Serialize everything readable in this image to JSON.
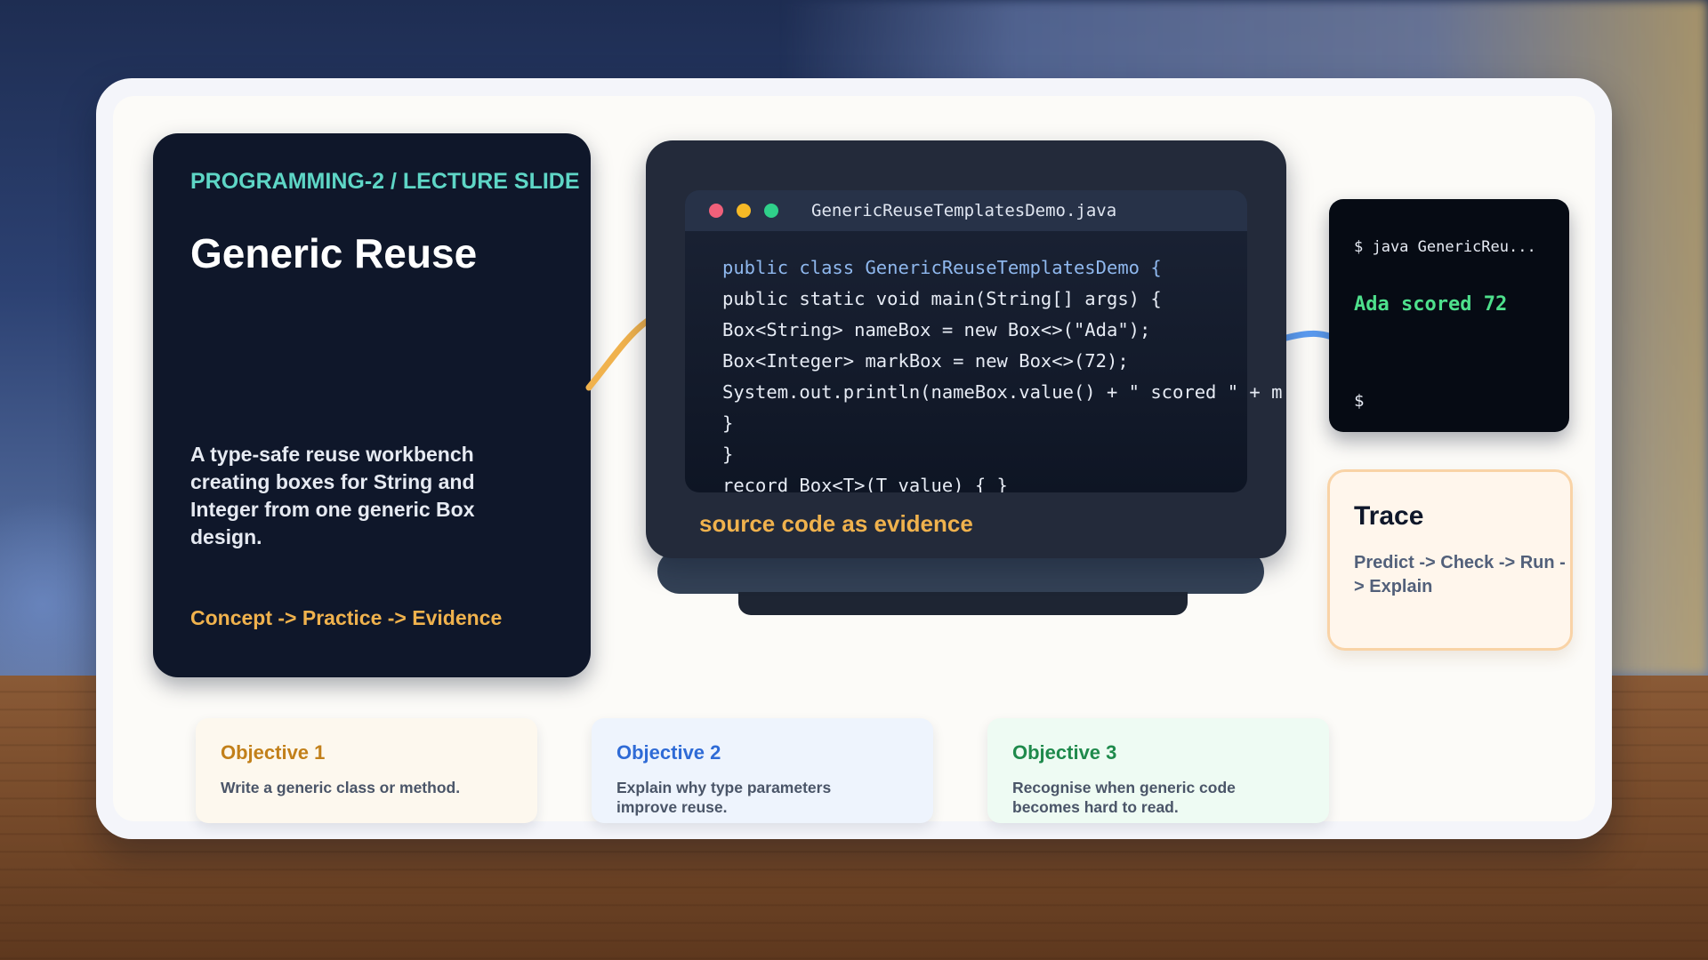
{
  "slide": {
    "eyebrow": "PROGRAMMING-2 / LECTURE SLIDE",
    "title": "Generic Reuse",
    "description": "A type-safe reuse workbench creating boxes for String and Integer from one generic Box design.",
    "flow": "Concept -> Practice -> Evidence"
  },
  "editor": {
    "filename": "GenericReuseTemplatesDemo.java",
    "lines": [
      "public class GenericReuseTemplatesDemo {",
      "public static void main(String[] args) {",
      "Box<String> nameBox = new Box<>(\"Ada\");",
      "Box<Integer> markBox = new Box<>(72);",
      "System.out.println(nameBox.value() + \" scored \" + mar..",
      "}",
      "}",
      "record Box<T>(T value) { }"
    ],
    "caption": "source code as evidence"
  },
  "terminal": {
    "command": "$ java GenericReu...",
    "output": "Ada scored 72",
    "prompt": "$"
  },
  "trace": {
    "title": "Trace",
    "text": "Predict -> Check -> Run -> Explain"
  },
  "objectives": [
    {
      "title": "Objective 1",
      "text": "Write a generic class or method.",
      "color": "#c2801a"
    },
    {
      "title": "Objective 2",
      "text": "Explain why type parameters improve reuse.",
      "color": "#2f6bd6"
    },
    {
      "title": "Objective 3",
      "text": "Recognise when generic code becomes hard to read.",
      "color": "#1f8a4c"
    }
  ],
  "colors": {
    "accent_teal": "#5ed6c6",
    "accent_amber": "#f0b24d",
    "terminal_green": "#4ee08c",
    "connector_blue": "#5b9bf0"
  }
}
